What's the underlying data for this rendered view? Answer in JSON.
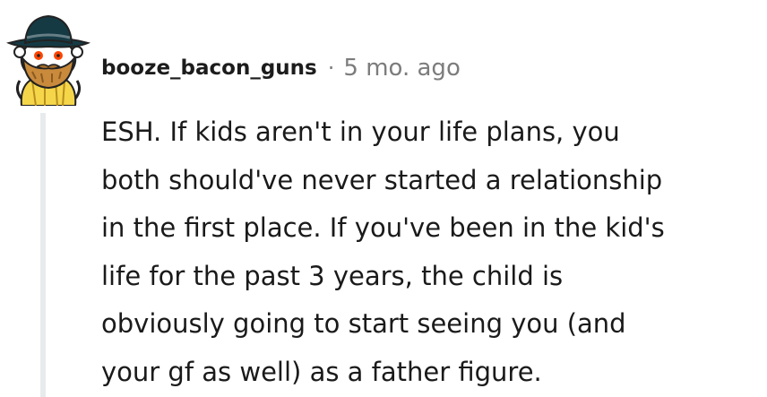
{
  "comment": {
    "author": "booze_bacon_guns",
    "separator": "·",
    "timestamp": "5 mo. ago",
    "body": "ESH. If kids aren't in your life plans, you\nboth should've never started a relationship\nin the first place. If you've been in the kid's\nlife for the past 3 years, the child is\nobviously going to start seeing you (and\nyour gf as well) as a father figure.",
    "avatar_icon": "snoo-avatar-icon"
  },
  "colors": {
    "text": "#1a1a1b",
    "meta": "#7c7c7c",
    "thread_line": "#e8ebed",
    "avatar_hat": "#153a44",
    "avatar_beard": "#c98a3c",
    "avatar_shirt": "#f5d64a"
  }
}
